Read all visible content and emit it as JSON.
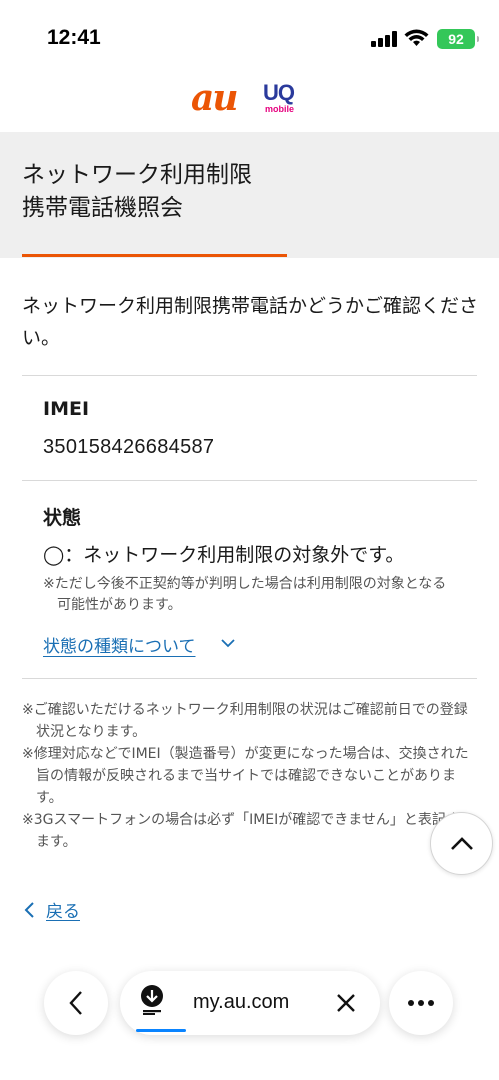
{
  "status_bar": {
    "time": "12:41",
    "battery": "92"
  },
  "brand": {
    "au": "au",
    "uq": "UQ",
    "uq_sub": "mobile"
  },
  "page": {
    "title": "ネットワーク利用制限\n携帯電話機照会",
    "intro": "ネットワーク利用制限携帯電話かどうかご確認ください。"
  },
  "imei": {
    "label": "IMEI",
    "value": "350158426684587"
  },
  "status": {
    "label": "状態",
    "value": "◯：ネットワーク利用制限の対象外です。",
    "note": "※ただし今後不正契約等が判明した場合は利用制限の対象となる可能性があります。",
    "types_link": "状態の種類について"
  },
  "notes": [
    "※ご確認いただけるネットワーク利用制限の状況はご確認前日での登録状況となります。",
    "※修理対応などでIMEI（製造番号）が変更になった場合は、交換された旨の情報が反映されるまで当サイトでは確認できないことがあります。",
    "※3Gスマートフォンの場合は必ず「IMEIが確認できません」と表記されます。"
  ],
  "back_link": "戻る",
  "browser": {
    "url": "my.au.com",
    "icons": [
      "back-icon",
      "download-icon",
      "close-icon",
      "more-icon"
    ]
  },
  "colors": {
    "accent": "#eb5505",
    "link": "#1a6fb4",
    "title_band": "#efefef",
    "battery": "#34c759"
  }
}
